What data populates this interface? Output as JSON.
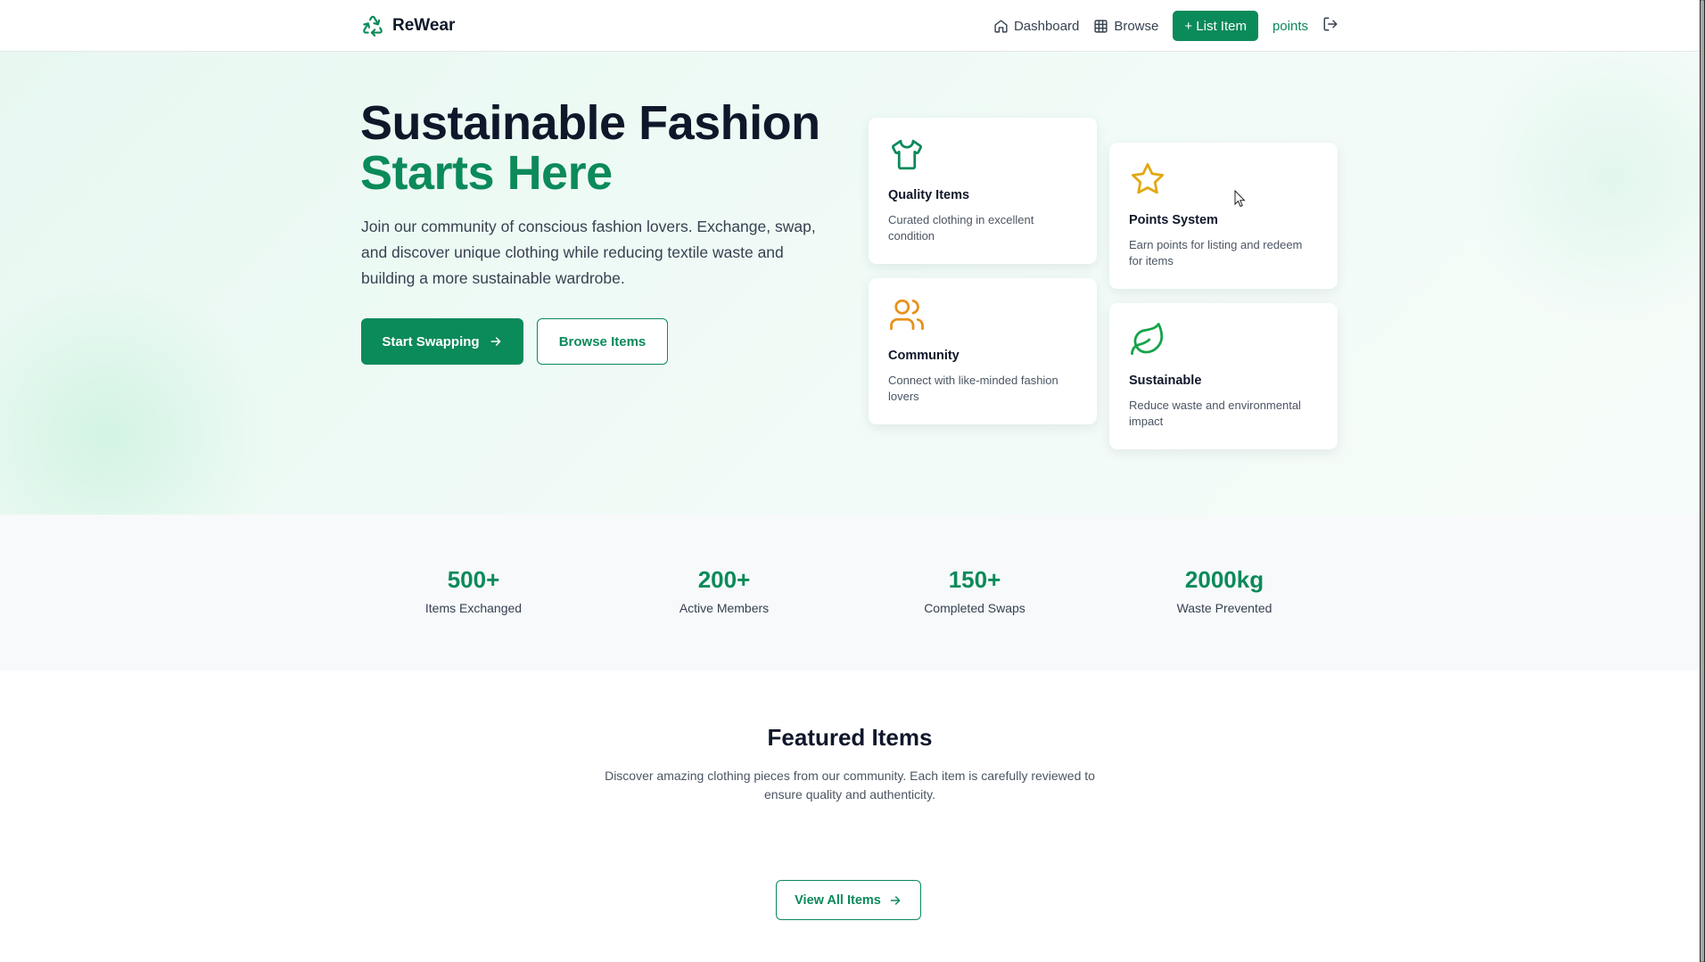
{
  "nav": {
    "brand": "ReWear",
    "links": [
      {
        "label": "Dashboard",
        "icon": "home-icon"
      },
      {
        "label": "Browse",
        "icon": "grid-icon"
      }
    ],
    "list_item_label": "+ List Item",
    "points_label": "points",
    "logout_icon": "logout-icon"
  },
  "hero": {
    "title_line1": "Sustainable Fashion",
    "title_line2": "Starts Here",
    "description": "Join our community of conscious fashion lovers. Exchange, swap, and discover unique clothing while reducing textile waste and building a more sustainable wardrobe.",
    "primary_button": "Start Swapping",
    "secondary_button": "Browse Items"
  },
  "features": [
    {
      "title": "Quality Items",
      "description": "Curated clothing in excellent condition",
      "icon": "shirt-icon",
      "color": "#0b8a5a"
    },
    {
      "title": "Points System",
      "description": "Earn points for listing and redeem for items",
      "icon": "star-icon",
      "color": "#e0a912"
    },
    {
      "title": "Community",
      "description": "Connect with like-minded fashion lovers",
      "icon": "users-icon",
      "color": "#e8911c"
    },
    {
      "title": "Sustainable",
      "description": "Reduce waste and environmental impact",
      "icon": "leaf-icon",
      "color": "#16a34a"
    }
  ],
  "stats": [
    {
      "value": "500+",
      "label": "Items Exchanged"
    },
    {
      "value": "200+",
      "label": "Active Members"
    },
    {
      "value": "150+",
      "label": "Completed Swaps"
    },
    {
      "value": "2000kg",
      "label": "Waste Prevented"
    }
  ],
  "featured": {
    "title": "Featured Items",
    "description": "Discover amazing clothing pieces from our community. Each item is carefully reviewed to ensure quality and authenticity.",
    "button": "View All Items"
  },
  "colors": {
    "brand": "#0b8a5a",
    "hero_bg": "#e8f8f1",
    "stats_bg": "#f7f9fa"
  }
}
